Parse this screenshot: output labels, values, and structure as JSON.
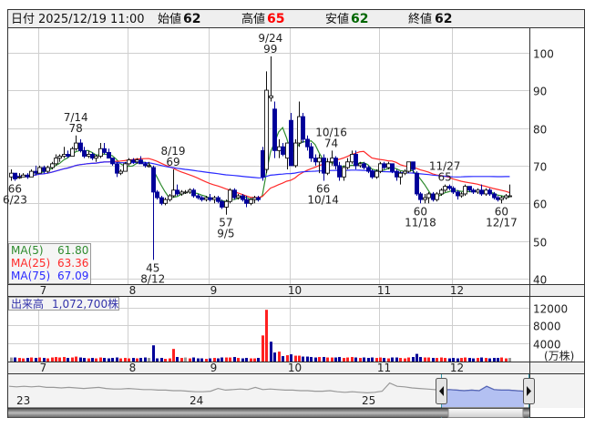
{
  "header": {
    "date_label": "日付",
    "datetime": "2025/12/19 11:00",
    "open_label": "始値",
    "open": "62",
    "high_label": "高値",
    "high": "65",
    "low_label": "安値",
    "low": "62",
    "close_label": "終値",
    "close": "62"
  },
  "colors": {
    "up_volume": "#ff2020",
    "down": "#000099",
    "flat": "#999999",
    "ma5": "#2e8b2e",
    "ma25": "#ff2a2a",
    "ma75": "#2a2aff",
    "high_text": "#ff0000",
    "low_text": "#006600"
  },
  "legend": [
    {
      "label": "MA(5)",
      "value": "61.80"
    },
    {
      "label": "MA(25)",
      "value": "63.36"
    },
    {
      "label": "MA(75)",
      "value": "67.09"
    }
  ],
  "volume_panel": {
    "label": "出来高",
    "value": "1,072,700株",
    "unit": "(万株)"
  },
  "navigator": {
    "year_labels": [
      "23",
      "24",
      "25"
    ],
    "series": [
      78,
      77,
      78,
      77,
      78,
      76,
      76,
      75,
      76,
      75,
      74,
      75,
      76,
      74,
      73,
      73,
      74,
      73,
      72,
      72,
      71,
      71,
      70,
      70,
      69,
      68,
      68,
      69,
      74,
      71,
      72,
      73,
      72,
      76,
      72,
      73,
      72,
      71,
      71,
      70,
      70,
      69,
      69,
      70,
      68,
      67,
      68,
      67,
      66,
      67,
      69,
      84,
      78,
      77,
      75,
      74,
      73,
      72,
      71,
      72,
      71,
      70,
      71,
      70,
      78,
      72,
      71,
      71,
      70,
      69
    ]
  },
  "chart_data": {
    "type": "candlestick",
    "title": "",
    "price_axis": {
      "ticks": [
        40,
        50,
        60,
        70,
        80,
        90,
        100
      ],
      "range": [
        40,
        105
      ]
    },
    "volume_axis": {
      "ticks": [
        4000,
        8000,
        12000
      ],
      "range": [
        0,
        12500
      ]
    },
    "month_labels": [
      {
        "label": "7",
        "index": 7
      },
      {
        "label": "8",
        "index": 29
      },
      {
        "label": "9",
        "index": 49
      },
      {
        "label": "10",
        "index": 69
      },
      {
        "label": "11",
        "index": 91
      },
      {
        "label": "12",
        "index": 109
      }
    ],
    "columns": [
      "date",
      "open",
      "high",
      "low",
      "close",
      "volume"
    ],
    "candles": [
      [
        "6/20",
        67,
        69,
        66,
        68,
        900
      ],
      [
        "6/23",
        68,
        68,
        66,
        66.5,
        900
      ],
      [
        "6/24",
        67,
        68,
        66.5,
        67,
        800
      ],
      [
        "6/25",
        67,
        68,
        67,
        67.5,
        700
      ],
      [
        "6/26",
        67.5,
        68,
        66.5,
        67,
        800
      ],
      [
        "6/27",
        67,
        69,
        67,
        68.5,
        900
      ],
      [
        "6/30",
        68.5,
        70,
        67.5,
        68,
        800
      ],
      [
        "7/1",
        68,
        70,
        68,
        69.5,
        900
      ],
      [
        "7/2",
        69.5,
        70,
        68,
        68.5,
        800
      ],
      [
        "7/3",
        68.5,
        70,
        68,
        69.5,
        700
      ],
      [
        "7/4",
        69.5,
        71,
        69,
        70.5,
        900
      ],
      [
        "7/7",
        70.5,
        73,
        70,
        72,
        1000
      ],
      [
        "7/8",
        72,
        73,
        71,
        72.5,
        900
      ],
      [
        "7/9",
        72.5,
        75,
        72,
        73,
        1000
      ],
      [
        "7/10",
        73,
        74,
        72,
        72.5,
        800
      ],
      [
        "7/11",
        72.5,
        75,
        72.5,
        74.5,
        900
      ],
      [
        "7/14",
        74.5,
        78,
        74,
        76,
        1100
      ],
      [
        "7/15",
        76,
        77,
        73.5,
        74,
        900
      ],
      [
        "7/16",
        74,
        75,
        72,
        72.5,
        800
      ],
      [
        "7/17",
        72.5,
        74,
        72,
        73,
        700
      ],
      [
        "7/18",
        73,
        73.5,
        71.5,
        72,
        800
      ],
      [
        "7/22",
        72,
        73,
        71,
        72.5,
        700
      ],
      [
        "7/23",
        72.5,
        76,
        72,
        74.5,
        900
      ],
      [
        "7/24",
        74.5,
        76,
        73,
        73.5,
        800
      ],
      [
        "7/25",
        73.5,
        74.5,
        72,
        72,
        700
      ],
      [
        "7/28",
        72,
        72,
        70,
        70.5,
        800
      ],
      [
        "7/29",
        70.5,
        71,
        67,
        68,
        900
      ],
      [
        "7/30",
        68,
        69,
        67.5,
        68.5,
        700
      ],
      [
        "7/31",
        68.5,
        71,
        68.5,
        70.5,
        800
      ],
      [
        "8/1",
        70.5,
        72,
        70,
        71.5,
        700
      ],
      [
        "8/4",
        71.5,
        72,
        70.5,
        71,
        800
      ],
      [
        "8/5",
        71,
        72,
        70.5,
        71.5,
        700
      ],
      [
        "8/6",
        71.5,
        72.5,
        70.5,
        70.5,
        800
      ],
      [
        "8/7",
        70.5,
        71,
        69.5,
        70,
        900
      ],
      [
        "8/8",
        70,
        71,
        69.5,
        70,
        800
      ],
      [
        "8/12",
        69.5,
        70,
        45,
        63,
        3600
      ],
      [
        "8/13",
        63,
        63.5,
        61,
        61.5,
        700
      ],
      [
        "8/14",
        61.5,
        62,
        59.5,
        60,
        800
      ],
      [
        "8/15",
        60,
        61.5,
        59.5,
        61,
        600
      ],
      [
        "8/18",
        61,
        62.5,
        60.5,
        62,
        700
      ],
      [
        "8/19",
        62,
        69,
        61.5,
        63.5,
        2800
      ],
      [
        "8/20",
        63.5,
        65,
        62,
        62.5,
        1000
      ],
      [
        "8/21",
        62.5,
        63.5,
        62,
        63,
        800
      ],
      [
        "8/22",
        63,
        63.5,
        62.5,
        63,
        900
      ],
      [
        "8/25",
        63,
        64,
        62.5,
        63.5,
        700
      ],
      [
        "8/26",
        63.5,
        64,
        61.5,
        62,
        900
      ],
      [
        "8/27",
        62,
        62.5,
        61,
        61.5,
        700
      ],
      [
        "8/28",
        61.5,
        62,
        60.5,
        61,
        700
      ],
      [
        "8/29",
        61,
        62,
        60.5,
        61.5,
        600
      ],
      [
        "9/1",
        61.5,
        62.5,
        60.5,
        61,
        700
      ],
      [
        "9/2",
        61,
        62,
        60,
        61.5,
        800
      ],
      [
        "9/3",
        61.5,
        62,
        60,
        60.5,
        700
      ],
      [
        "9/4",
        60.5,
        61,
        58.5,
        59,
        900
      ],
      [
        "9/5",
        59,
        61,
        57,
        60.5,
        900
      ],
      [
        "9/8",
        60.5,
        64,
        60,
        63.5,
        900
      ],
      [
        "9/9",
        63.5,
        64,
        61,
        61.5,
        1000
      ],
      [
        "9/10",
        61.5,
        62.5,
        61,
        62,
        800
      ],
      [
        "9/11",
        62,
        62.5,
        60.5,
        61,
        700
      ],
      [
        "9/12",
        61,
        62,
        59,
        60,
        800
      ],
      [
        "9/16",
        60,
        61.5,
        59.5,
        61,
        700
      ],
      [
        "9/17",
        61,
        62,
        60,
        61.5,
        700
      ],
      [
        "9/18",
        61.5,
        62,
        60.5,
        61,
        800
      ],
      [
        "9/19",
        74,
        75,
        66,
        67,
        5800
      ],
      [
        "9/22",
        69,
        95,
        68,
        90,
        11500
      ],
      [
        "9/24",
        88,
        99,
        87,
        88.5,
        4400
      ],
      [
        "9/25",
        85,
        87,
        72,
        74,
        2000
      ],
      [
        "9/26",
        74,
        77,
        72,
        75,
        2200
      ],
      [
        "9/29",
        75,
        76,
        72.5,
        73,
        1200
      ],
      [
        "9/30",
        72,
        76,
        69,
        76,
        1400
      ],
      [
        "10/1",
        82,
        84,
        70,
        70,
        1600
      ],
      [
        "10/2",
        70,
        77,
        69.5,
        76,
        1300
      ],
      [
        "10/3",
        76,
        87,
        75,
        83,
        1300
      ],
      [
        "10/6",
        83,
        84,
        76,
        77,
        1100
      ],
      [
        "10/7",
        77,
        78,
        74,
        75,
        1100
      ],
      [
        "10/8",
        75,
        76,
        71,
        72,
        1000
      ],
      [
        "10/9",
        72,
        73,
        70,
        71,
        900
      ],
      [
        "10/10",
        71,
        73,
        68,
        72,
        1000
      ],
      [
        "10/14",
        72,
        73,
        66,
        68,
        1000
      ],
      [
        "10/15",
        68,
        72,
        67.5,
        71,
        900
      ],
      [
        "10/16",
        71,
        74,
        70,
        72,
        900
      ],
      [
        "10/17",
        72,
        72.5,
        69,
        70,
        900
      ],
      [
        "10/20",
        70,
        71,
        66,
        67,
        1000
      ],
      [
        "10/21",
        67,
        70,
        66,
        69.5,
        800
      ],
      [
        "10/22",
        69.5,
        72,
        69,
        71,
        900
      ],
      [
        "10/23",
        71,
        74,
        70.5,
        73,
        1000
      ],
      [
        "10/24",
        73,
        74,
        69,
        70,
        900
      ],
      [
        "10/27",
        70,
        71,
        69.5,
        70.5,
        800
      ],
      [
        "10/28",
        70.5,
        71,
        69,
        69.5,
        900
      ],
      [
        "10/29",
        69.5,
        70,
        68,
        68.5,
        800
      ],
      [
        "10/30",
        68.5,
        69,
        66.5,
        67,
        900
      ],
      [
        "10/31",
        67,
        69,
        66.5,
        68.5,
        800
      ],
      [
        "11/4",
        68.5,
        71,
        68,
        70.5,
        900
      ],
      [
        "11/5",
        70.5,
        71,
        69,
        69.5,
        800
      ],
      [
        "11/6",
        69.5,
        71,
        69,
        70.5,
        700
      ],
      [
        "11/7",
        70.5,
        70.5,
        68,
        68.5,
        900
      ],
      [
        "11/10",
        68.5,
        69,
        66,
        67,
        900
      ],
      [
        "11/11",
        67,
        68.5,
        65,
        68,
        800
      ],
      [
        "11/12",
        68,
        69,
        67.5,
        68.5,
        700
      ],
      [
        "11/13",
        68.5,
        71,
        68,
        71,
        900
      ],
      [
        "11/14",
        71,
        71,
        68,
        69,
        1000
      ],
      [
        "11/17",
        68,
        68.5,
        62,
        62.5,
        1700
      ],
      [
        "11/18",
        62.5,
        63,
        60,
        61,
        1000
      ],
      [
        "11/19",
        61,
        62.5,
        60,
        61.5,
        900
      ],
      [
        "11/20",
        61.5,
        63,
        60,
        62.5,
        900
      ],
      [
        "11/21",
        62.5,
        63,
        60.5,
        61,
        800
      ],
      [
        "11/25",
        61,
        63,
        60.5,
        62.5,
        800
      ],
      [
        "11/26",
        62.5,
        64,
        62,
        63.5,
        900
      ],
      [
        "11/27",
        63.5,
        65,
        63,
        64.5,
        800
      ],
      [
        "11/28",
        64.5,
        65,
        63.5,
        64,
        700
      ],
      [
        "12/1",
        64,
        64.5,
        62.5,
        63,
        800
      ],
      [
        "12/2",
        63,
        63.5,
        61,
        62,
        700
      ],
      [
        "12/3",
        62,
        63,
        61.5,
        62.5,
        800
      ],
      [
        "12/4",
        62.5,
        65,
        62,
        64.5,
        900
      ],
      [
        "12/5",
        64.5,
        64.5,
        63,
        63.5,
        800
      ],
      [
        "12/8",
        63.5,
        64,
        62.5,
        63,
        700
      ],
      [
        "12/9",
        63,
        64,
        62.5,
        63.5,
        800
      ],
      [
        "12/10",
        63.5,
        65,
        62,
        62.5,
        900
      ],
      [
        "12/11",
        62.5,
        64,
        62,
        63.5,
        800
      ],
      [
        "12/12",
        63.5,
        64,
        62,
        62.5,
        700
      ],
      [
        "12/15",
        62.5,
        63,
        61,
        61.5,
        800
      ],
      [
        "12/16",
        61.5,
        62,
        60.5,
        61,
        800
      ],
      [
        "12/17",
        61,
        62,
        60,
        61.5,
        900
      ],
      [
        "12/18",
        61.5,
        62.5,
        61,
        62,
        700
      ],
      [
        "12/19",
        62,
        65,
        62,
        62,
        800
      ]
    ],
    "annotations": [
      {
        "date": "6/23",
        "value": "66",
        "type": "low"
      },
      {
        "date": "7/14",
        "value": "78",
        "type": "high"
      },
      {
        "date": "8/12",
        "value": "45",
        "type": "low"
      },
      {
        "date": "8/19",
        "value": "69",
        "type": "high"
      },
      {
        "date": "9/5",
        "value": "57",
        "type": "low"
      },
      {
        "date": "9/24",
        "value": "99",
        "type": "high"
      },
      {
        "date": "10/14",
        "value": "66",
        "type": "low"
      },
      {
        "date": "10/16",
        "value": "74",
        "type": "high"
      },
      {
        "date": "11/18",
        "value": "60",
        "type": "low"
      },
      {
        "date": "11/27",
        "value": "65",
        "type": "high"
      },
      {
        "date": "12/17",
        "value": "60",
        "type": "low"
      }
    ]
  }
}
